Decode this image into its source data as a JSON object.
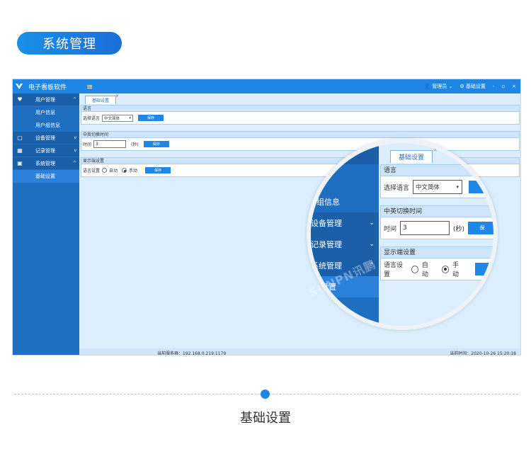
{
  "banner": {
    "title": "系统管理"
  },
  "app": {
    "title": "电子看板软件",
    "menu_icon": "≡",
    "user": "管理员",
    "settings": "基础设置",
    "window_controls": [
      "-",
      "▫",
      "×"
    ],
    "sidebar": {
      "groups": [
        {
          "label": "用户管理",
          "icon": "users-icon",
          "expanded": true,
          "items": [
            "用户信息",
            "用户组信息"
          ]
        },
        {
          "label": "设备管理",
          "icon": "monitor-icon",
          "expanded": false,
          "items": []
        },
        {
          "label": "记录管理",
          "icon": "record-icon",
          "expanded": false,
          "items": []
        },
        {
          "label": "系统管理",
          "icon": "box-icon",
          "expanded": true,
          "items": [
            "基础设置"
          ]
        }
      ]
    },
    "tab": {
      "label": "基础设置"
    },
    "panels": {
      "language": {
        "header": "语言",
        "label": "选择语言",
        "value": "中文简体",
        "save": "保存"
      },
      "switch": {
        "header": "中英切换时间",
        "label": "时间",
        "value": "3",
        "unit": "(秒)",
        "save": "保存"
      },
      "display": {
        "header": "显示端设置",
        "label": "语言设置",
        "opt_auto": "自动",
        "opt_manual": "手动",
        "selected": "手动",
        "save": "保存"
      }
    },
    "status": {
      "server": "当前服务器：192.168.0.219:1179",
      "time": "当前时间：2020-10-26 15:20:18"
    }
  },
  "zoom": {
    "sidebar_items": [
      "组信息",
      "设备管理",
      "记录管理",
      "系统管理",
      "设置"
    ],
    "save_partial": "保"
  },
  "watermark": "SUNPN讯鹏",
  "caption": "基础设置",
  "colors": {
    "accent": "#1e86e4",
    "sidebar": "#1e6fc2"
  }
}
